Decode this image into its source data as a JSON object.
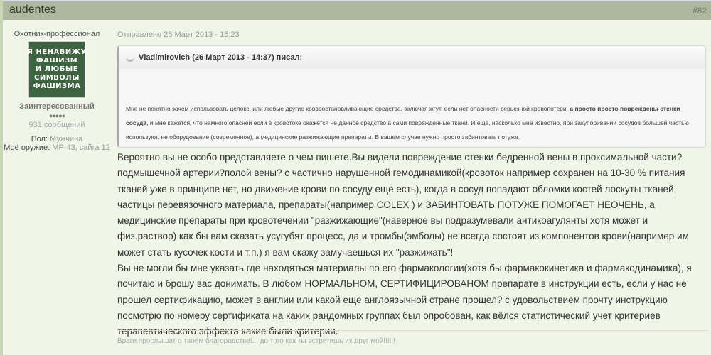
{
  "post": {
    "author": "audentes",
    "number": "#82",
    "sent": "Отправлено 26 Март 2013 - 15:23"
  },
  "user": {
    "title": "Охотник-профессионал",
    "avatar_text": "Я НЕНАВИЖУ\nФАШИЗМ\nИ ЛЮБЫЕ\nСИМВОЛЫ\nФАШИЗМА",
    "group": "Заинтересованный",
    "pips": "●●●●●",
    "posts": "931 сообщений",
    "gender_label": "Пол:",
    "gender": "Мужчина",
    "weapon_label": "Моё оружие:",
    "weapon": "МР-43, сайга 12"
  },
  "quote": {
    "header": "Vladimirovich (26 Март 2013 - 14:37) писал:",
    "text1": "Мне не понятно зачем использовать целокс, или любые другие кровоостанавливающие средства, включая жгут, если нет опасности серьезной кровопотери, ",
    "bold": "а просто просто повреждены стенки сосуда",
    "text2": ", и мне кажется, что намного опасней если в кровотоке окажется не данное средство а сами поврежденные ткани. И еще, насколько мне известно, при закупоривании сосудов большей частью используют, не оборудование (современное), а медицинские разжижающие препараты. В вашем случае нужно просто забинтовать потуже."
  },
  "body": {
    "p1": "Вероятно вы не особо представляете о чем пишете.Вы видели повреждение стенки бедренной вены в проксимальной части? подмышечной артерии?полой вены? с частично нарушенной гемодинамикой(кровоток например сохранен на 10-30 % питания тканей уже в принципе нет, но движение крови по сосуду ещё есть), когда в сосуд попадают обломки костей лоскуты тканей, частицы перевязочного материала, препараты(например COLEX ) и ЗАБИНТОВАТЬ ПОТУЖЕ ПОМОГАЕТ НЕОЧЕНЬ, а медицинские препараты при кровотечении \"разжижающие\"(наверное вы подразумевали антикоагулянты хотя может и физ.раствор) как бы вам сказать усугубят процесс, да и тромбы(эмболы) не всегда состоят из компонентов крови(например им может стать кусочек кости и т.п.) я вам скажу замучаешься их \"разжижать\"!",
    "p2": "Вы не могли бы мне указать где находяться материалы по его фармакологии(хотя бы фармакокинетика и фармакодинамика), я почитаю и брошу вас донимать. В любом НОРМАЛЬНОМ, СЕРТИФИЦИРОВАНОМ препарате в инструкции есть, если у нас не прошел сертификацию, может в англии или какой ещё англоязычной стране прощел? с удовольствием прочту инструкцию посмотрю по номеру сертификата на каких рандомных группах был опробован, как вёлся статистический учет критериев терапевтического эффекта какие были критерии."
  },
  "signature": "Враги прослышат о твоём благородстве!... до того как ты встретишь их друг мой!!!!!!"
}
